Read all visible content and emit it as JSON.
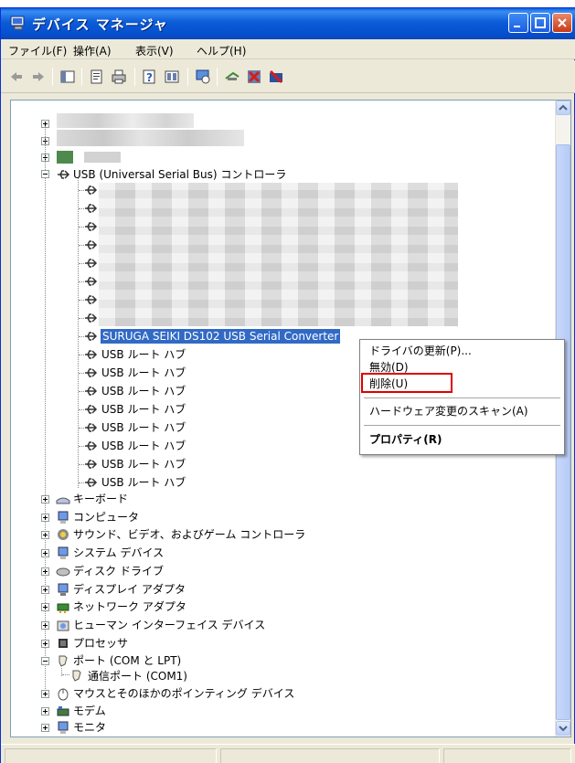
{
  "window": {
    "title": "デバイス マネージャ"
  },
  "menubar": {
    "items": [
      "ファイル(F)",
      "操作(A)",
      "表示(V)",
      "ヘルプ(H)"
    ]
  },
  "toolbar": {
    "icons": [
      "back-icon",
      "forward-icon",
      "console-tree-icon",
      "properties-icon",
      "print-icon",
      "help-icon",
      "view-icon",
      "scan-hardware-icon",
      "update-driver-icon",
      "disable-icon",
      "uninstall-icon"
    ]
  },
  "tree": {
    "usb_controller": "USB (Universal Serial Bus) コントローラ",
    "usb_selected_device": "SURUGA SEIKI DS102 USB Serial Converter",
    "usb_root_hubs": [
      "USB ルート ハブ",
      "USB ルート ハブ",
      "USB ルート ハブ",
      "USB ルート ハブ",
      "USB ルート ハブ",
      "USB ルート ハブ",
      "USB ルート ハブ",
      "USB ルート ハブ"
    ],
    "categories": [
      "キーボード",
      "コンピュータ",
      "サウンド、ビデオ、およびゲーム コントローラ",
      "システム デバイス",
      "ディスク ドライブ",
      "ディスプレイ アダプタ",
      "ネットワーク アダプタ",
      "ヒューマン インターフェイス デバイス",
      "プロセッサ"
    ],
    "ports_category": "ポート (COM と LPT)",
    "ports_child": "通信ポート (COM1)",
    "after_categories": [
      "マウスとそのほかのポインティング デバイス",
      "モデム",
      "モニタ"
    ]
  },
  "context_menu": {
    "update_driver": "ドライバの更新(P)...",
    "disable": "無効(D)",
    "uninstall": "削除(U)",
    "scan_hardware": "ハードウェア変更のスキャン(A)",
    "properties": "プロパティ(R)"
  },
  "colors": {
    "title_bar": "#0a5bd8",
    "selection": "#316ac5",
    "highlight_box": "#e00000"
  }
}
